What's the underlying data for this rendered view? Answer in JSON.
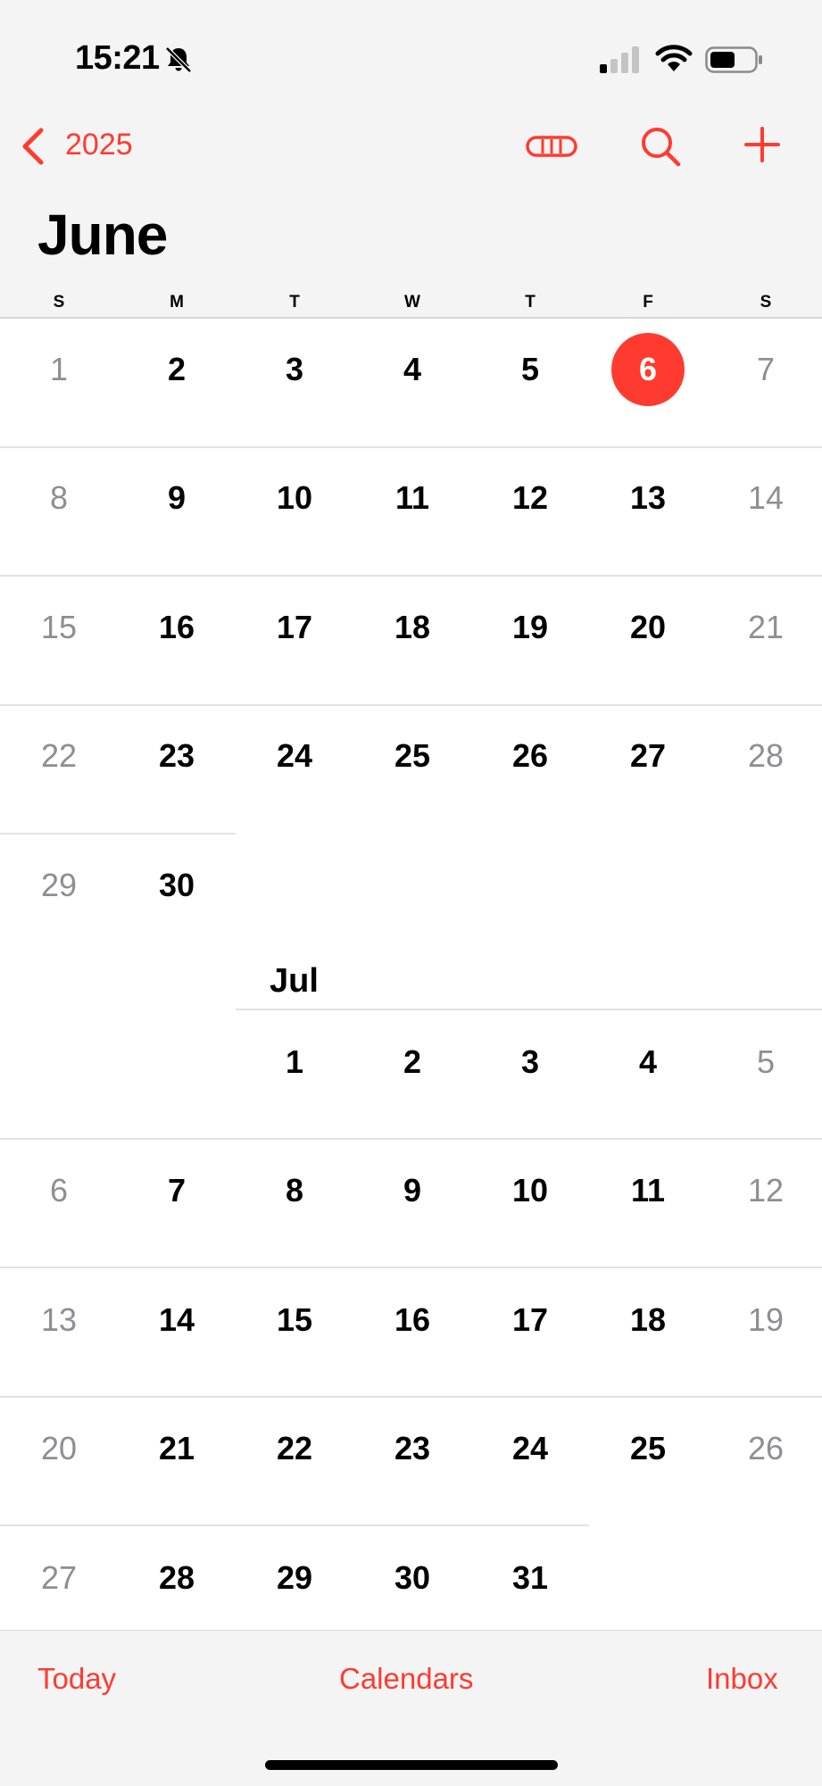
{
  "status_bar": {
    "time": "15:21",
    "icons": [
      "bell-slash-icon",
      "signal-icon",
      "wifi-icon",
      "battery-icon"
    ]
  },
  "nav": {
    "back_label": "2025",
    "icons": [
      "chevron-left-icon",
      "list-view-icon",
      "search-icon",
      "plus-icon"
    ]
  },
  "month_title": "June",
  "weekdays": [
    "S",
    "M",
    "T",
    "W",
    "T",
    "F",
    "S"
  ],
  "june": {
    "weeks": [
      [
        "1",
        "2",
        "3",
        "4",
        "5",
        "6",
        "7"
      ],
      [
        "8",
        "9",
        "10",
        "11",
        "12",
        "13",
        "14"
      ],
      [
        "15",
        "16",
        "17",
        "18",
        "19",
        "20",
        "21"
      ],
      [
        "22",
        "23",
        "24",
        "25",
        "26",
        "27",
        "28"
      ],
      [
        "29",
        "30"
      ]
    ],
    "today": "6"
  },
  "july": {
    "label": "Jul",
    "weeks": [
      [
        "",
        "",
        "1",
        "2",
        "3",
        "4",
        "5"
      ],
      [
        "6",
        "7",
        "8",
        "9",
        "10",
        "11",
        "12"
      ],
      [
        "13",
        "14",
        "15",
        "16",
        "17",
        "18",
        "19"
      ],
      [
        "20",
        "21",
        "22",
        "23",
        "24",
        "25",
        "26"
      ],
      [
        "27",
        "28",
        "29",
        "30",
        "31"
      ]
    ]
  },
  "tabbar": {
    "today": "Today",
    "calendars": "Calendars",
    "inbox": "Inbox"
  },
  "colors": {
    "accent": "#ff3b30",
    "weekend": "#8e8e93",
    "background": "#ffffff",
    "header": "#f5f4f4"
  }
}
